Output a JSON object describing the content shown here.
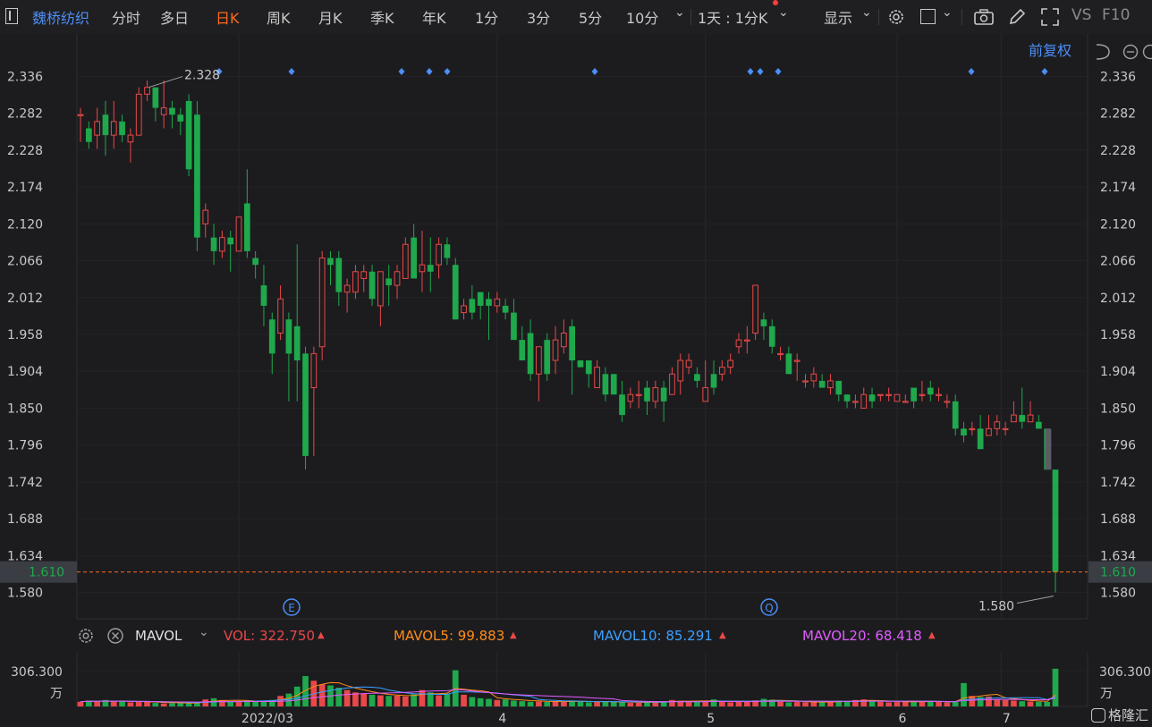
{
  "toolbar": {
    "stock_name": "魏桥纺织",
    "periods": [
      "分时",
      "多日",
      "日K",
      "周K",
      "月K",
      "季K",
      "年K",
      "1分",
      "3分",
      "5分",
      "10分"
    ],
    "active_period": "日K",
    "interval": "1天 : 1分K",
    "display_label": "显示",
    "vs_label": "VS",
    "f10_label": "F10"
  },
  "chart_header": {
    "adjust_label": "前复权"
  },
  "colors": {
    "up": "#e84848",
    "down": "#1fa84c",
    "accent": "#ff6a1e",
    "link": "#4c8ef7",
    "ma5": "#ff8c1a",
    "ma10": "#3ca0ff",
    "ma20": "#e05cff",
    "background": "#1c1c1f"
  },
  "chart_data": [
    {
      "type": "candlestick",
      "y_ticks": [
        "2.336",
        "2.282",
        "2.228",
        "2.174",
        "2.120",
        "2.066",
        "2.012",
        "1.958",
        "1.904",
        "1.850",
        "1.796",
        "1.742",
        "1.688",
        "1.634",
        "1.580"
      ],
      "ylim": [
        1.565,
        2.372
      ],
      "x_labels": [
        "2022/03",
        "4",
        "5",
        "6",
        "7"
      ],
      "current_price": "1.610",
      "high_annotation": "2.328",
      "low_annotation": "1.580",
      "markers": [
        "E",
        "Q"
      ],
      "candles": [
        [
          2.28,
          2.28,
          2.24,
          2.29
        ],
        [
          2.26,
          2.24,
          2.23,
          2.27
        ],
        [
          2.25,
          2.27,
          2.23,
          2.29
        ],
        [
          2.28,
          2.25,
          2.22,
          2.3
        ],
        [
          2.25,
          2.27,
          2.23,
          2.3
        ],
        [
          2.27,
          2.25,
          2.24,
          2.28
        ],
        [
          2.24,
          2.25,
          2.21,
          2.26
        ],
        [
          2.25,
          2.31,
          2.25,
          2.32
        ],
        [
          2.31,
          2.32,
          2.3,
          2.33
        ],
        [
          2.32,
          2.29,
          2.27,
          2.32
        ],
        [
          2.28,
          2.29,
          2.26,
          2.33
        ],
        [
          2.29,
          2.28,
          2.26,
          2.3
        ],
        [
          2.28,
          2.27,
          2.25,
          2.29
        ],
        [
          2.3,
          2.2,
          2.19,
          2.31
        ],
        [
          2.28,
          2.1,
          2.08,
          2.3
        ],
        [
          2.12,
          2.14,
          2.1,
          2.15
        ],
        [
          2.1,
          2.08,
          2.06,
          2.12
        ],
        [
          2.08,
          2.1,
          2.07,
          2.11
        ],
        [
          2.1,
          2.09,
          2.05,
          2.11
        ],
        [
          2.08,
          2.13,
          2.08,
          2.13
        ],
        [
          2.15,
          2.08,
          2.07,
          2.2
        ],
        [
          2.07,
          2.06,
          2.04,
          2.08
        ],
        [
          2.03,
          2.0,
          1.97,
          2.06
        ],
        [
          1.98,
          1.93,
          1.9,
          1.99
        ],
        [
          1.96,
          2.01,
          1.95,
          2.03
        ],
        [
          1.98,
          1.93,
          1.86,
          1.99
        ],
        [
          1.97,
          1.92,
          1.86,
          2.09
        ],
        [
          1.93,
          1.78,
          1.76,
          1.94
        ],
        [
          1.88,
          1.93,
          1.78,
          1.94
        ],
        [
          1.94,
          2.07,
          1.92,
          2.08
        ],
        [
          2.07,
          2.06,
          2.03,
          2.08
        ],
        [
          2.07,
          2.02,
          2.0,
          2.08
        ],
        [
          2.02,
          2.03,
          1.99,
          2.04
        ],
        [
          2.02,
          2.05,
          2.01,
          2.06
        ],
        [
          2.04,
          2.05,
          2.02,
          2.06
        ],
        [
          2.05,
          2.01,
          2.0,
          2.06
        ],
        [
          2.0,
          2.05,
          1.97,
          2.05
        ],
        [
          2.04,
          2.03,
          2.0,
          2.06
        ],
        [
          2.03,
          2.05,
          2.01,
          2.06
        ],
        [
          2.04,
          2.09,
          2.04,
          2.1
        ],
        [
          2.1,
          2.04,
          2.04,
          2.12
        ],
        [
          2.05,
          2.06,
          2.02,
          2.11
        ],
        [
          2.06,
          2.05,
          2.02,
          2.1
        ],
        [
          2.06,
          2.09,
          2.04,
          2.1
        ],
        [
          2.09,
          2.07,
          2.06,
          2.1
        ],
        [
          2.06,
          1.98,
          1.98,
          2.07
        ],
        [
          1.99,
          2.0,
          1.98,
          2.01
        ],
        [
          2.01,
          1.99,
          1.98,
          2.03
        ],
        [
          2.02,
          2.0,
          1.98,
          2.02
        ],
        [
          2.01,
          2.0,
          1.95,
          2.02
        ],
        [
          2.0,
          2.01,
          1.99,
          2.02
        ],
        [
          2.0,
          1.99,
          1.98,
          2.01
        ],
        [
          1.99,
          1.95,
          1.95,
          2.01
        ],
        [
          1.95,
          1.92,
          1.92,
          1.97
        ],
        [
          1.96,
          1.9,
          1.89,
          1.98
        ],
        [
          1.9,
          1.94,
          1.86,
          1.94
        ],
        [
          1.95,
          1.9,
          1.89,
          1.96
        ],
        [
          1.92,
          1.95,
          1.9,
          1.97
        ],
        [
          1.94,
          1.96,
          1.93,
          1.98
        ],
        [
          1.97,
          1.92,
          1.87,
          1.98
        ],
        [
          1.92,
          1.91,
          1.91,
          1.92
        ],
        [
          1.92,
          1.9,
          1.88,
          1.92
        ],
        [
          1.88,
          1.91,
          1.88,
          1.92
        ],
        [
          1.9,
          1.87,
          1.86,
          1.91
        ],
        [
          1.9,
          1.87,
          1.87,
          1.9
        ],
        [
          1.87,
          1.84,
          1.83,
          1.89
        ],
        [
          1.86,
          1.87,
          1.85,
          1.88
        ],
        [
          1.87,
          1.87,
          1.85,
          1.89
        ],
        [
          1.88,
          1.86,
          1.84,
          1.89
        ],
        [
          1.86,
          1.88,
          1.85,
          1.89
        ],
        [
          1.88,
          1.86,
          1.83,
          1.89
        ],
        [
          1.87,
          1.9,
          1.87,
          1.91
        ],
        [
          1.89,
          1.92,
          1.87,
          1.93
        ],
        [
          1.91,
          1.92,
          1.9,
          1.93
        ],
        [
          1.9,
          1.89,
          1.88,
          1.91
        ],
        [
          1.86,
          1.88,
          1.86,
          1.92
        ],
        [
          1.9,
          1.88,
          1.87,
          1.92
        ],
        [
          1.9,
          1.91,
          1.89,
          1.92
        ],
        [
          1.91,
          1.92,
          1.9,
          1.93
        ],
        [
          1.94,
          1.95,
          1.93,
          1.96
        ],
        [
          1.95,
          1.95,
          1.93,
          1.97
        ],
        [
          1.96,
          2.03,
          1.95,
          2.03
        ],
        [
          1.98,
          1.97,
          1.95,
          1.99
        ],
        [
          1.97,
          1.94,
          1.93,
          1.98
        ],
        [
          1.93,
          1.93,
          1.92,
          1.94
        ],
        [
          1.93,
          1.9,
          1.9,
          1.94
        ],
        [
          1.92,
          1.92,
          1.89,
          1.93
        ],
        [
          1.89,
          1.89,
          1.88,
          1.9
        ],
        [
          1.89,
          1.9,
          1.88,
          1.91
        ],
        [
          1.89,
          1.88,
          1.88,
          1.9
        ],
        [
          1.88,
          1.89,
          1.87,
          1.9
        ],
        [
          1.89,
          1.87,
          1.86,
          1.89
        ],
        [
          1.87,
          1.86,
          1.85,
          1.87
        ],
        [
          1.86,
          1.86,
          1.85,
          1.87
        ],
        [
          1.85,
          1.87,
          1.85,
          1.88
        ],
        [
          1.87,
          1.86,
          1.85,
          1.88
        ],
        [
          1.87,
          1.87,
          1.86,
          1.87
        ],
        [
          1.87,
          1.87,
          1.86,
          1.88
        ],
        [
          1.86,
          1.87,
          1.86,
          1.87
        ],
        [
          1.86,
          1.86,
          1.86,
          1.87
        ],
        [
          1.88,
          1.86,
          1.85,
          1.88
        ],
        [
          1.87,
          1.87,
          1.86,
          1.89
        ],
        [
          1.88,
          1.87,
          1.86,
          1.89
        ],
        [
          1.87,
          1.87,
          1.86,
          1.88
        ],
        [
          1.86,
          1.86,
          1.85,
          1.87
        ],
        [
          1.86,
          1.82,
          1.81,
          1.87
        ],
        [
          1.82,
          1.81,
          1.8,
          1.83
        ],
        [
          1.82,
          1.82,
          1.81,
          1.83
        ],
        [
          1.82,
          1.79,
          1.79,
          1.84
        ],
        [
          1.81,
          1.82,
          1.81,
          1.84
        ],
        [
          1.82,
          1.83,
          1.81,
          1.84
        ],
        [
          1.82,
          1.82,
          1.81,
          1.83
        ],
        [
          1.83,
          1.84,
          1.83,
          1.86
        ],
        [
          1.84,
          1.83,
          1.82,
          1.88
        ],
        [
          1.83,
          1.84,
          1.83,
          1.86
        ],
        [
          1.83,
          1.82,
          1.82,
          1.84
        ],
        [
          1.82,
          1.76,
          1.76,
          1.82
        ],
        [
          1.76,
          1.61,
          1.58,
          1.76
        ]
      ],
      "gray_candle": [
        1.82,
        1.76
      ]
    },
    {
      "type": "bar",
      "indicator_name": "MAVOL",
      "vol_label": "VOL: 322.750",
      "ma5_label": "MAVOL5: 99.883",
      "ma10_label": "MAVOL10: 85.291",
      "ma20_label": "MAVOL20: 68.418",
      "y_tick": "306.300",
      "y_unit": "万",
      "values": [
        40,
        50,
        40,
        55,
        42,
        45,
        35,
        38,
        42,
        30,
        25,
        28,
        32,
        30,
        35,
        60,
        70,
        55,
        40,
        38,
        50,
        45,
        48,
        55,
        90,
        110,
        170,
        260,
        220,
        190,
        180,
        160,
        140,
        120,
        110,
        100,
        95,
        90,
        92,
        85,
        105,
        140,
        120,
        95,
        110,
        310,
        100,
        80,
        70,
        65,
        55,
        60,
        50,
        45,
        40,
        42,
        38,
        45,
        40,
        50,
        42,
        35,
        40,
        45,
        38,
        35,
        30,
        32,
        38,
        40,
        45,
        55,
        48,
        38,
        42,
        50,
        60,
        40,
        35,
        38,
        45,
        52,
        65,
        58,
        40,
        35,
        38,
        36,
        42,
        35,
        40,
        50,
        48,
        55,
        60,
        45,
        40,
        35,
        38,
        40,
        45,
        42,
        48,
        38,
        35,
        40,
        200,
        90,
        80,
        85,
        60,
        55,
        50,
        45,
        42,
        40,
        38,
        322.75
      ]
    }
  ],
  "watermark": "格隆汇"
}
